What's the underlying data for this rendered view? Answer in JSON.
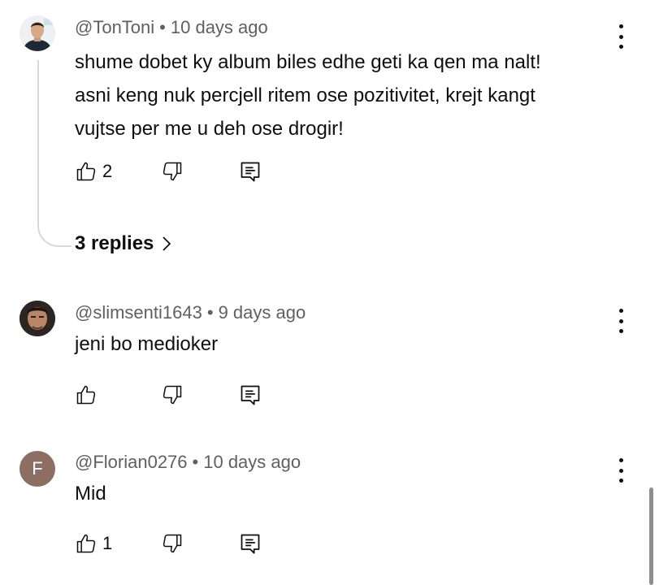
{
  "comments": [
    {
      "author": "@TonToni",
      "time": "10 days ago",
      "text_lines": [
        "shume dobet ky album biles edhe geti ka qen ma nalt!",
        "asni keng nuk percjell ritem ose pozitivitet, krejt kangt",
        "vujtse per me u deh ose drogir!"
      ],
      "likes": "2",
      "replies_label": "3 replies",
      "avatar": "photo-avatar"
    },
    {
      "author": "@slimsenti1643",
      "time": "9 days ago",
      "text_lines": [
        "jeni bo medioker"
      ],
      "likes": "",
      "avatar": "photo-avatar"
    },
    {
      "author": "@Florian0276",
      "time": "10 days ago",
      "text_lines": [
        "Mid"
      ],
      "likes": "1",
      "avatar_letter": "F",
      "avatar_color": "#8d6e63"
    }
  ],
  "separator": "•",
  "icons": {
    "like": "thumbs-up-icon",
    "dislike": "thumbs-down-icon",
    "reply": "reply-icon",
    "menu": "more-vert-icon",
    "chevron": "chevron-right-icon"
  }
}
